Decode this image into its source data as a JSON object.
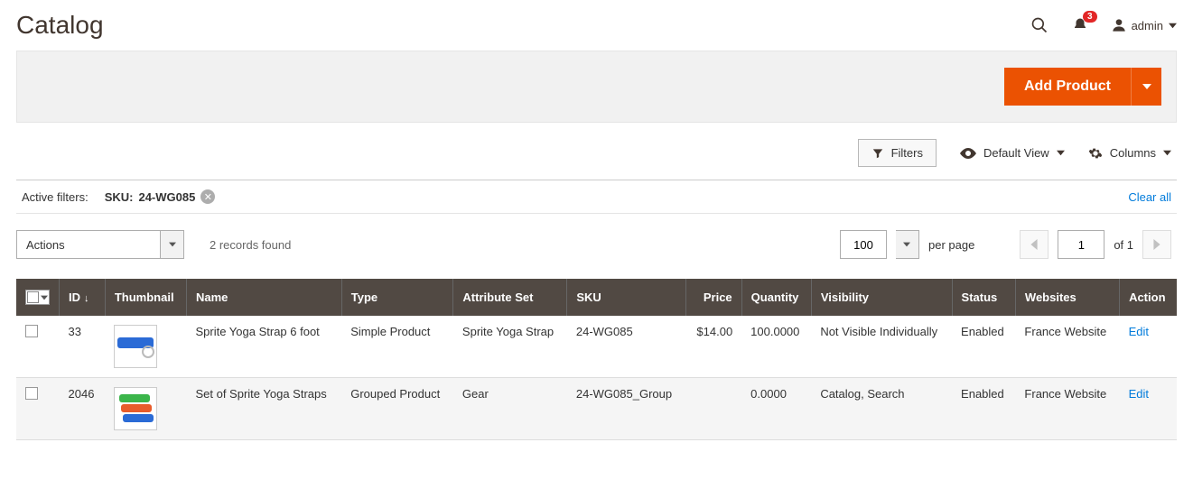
{
  "header": {
    "title": "Catalog",
    "notification_count": "3",
    "admin_label": "admin"
  },
  "toolbar": {
    "add_product_label": "Add Product"
  },
  "controls": {
    "filters_label": "Filters",
    "default_view_label": "Default View",
    "columns_label": "Columns"
  },
  "active_filters": {
    "label": "Active filters:",
    "chip_key": "SKU:",
    "chip_value": "24-WG085",
    "clear_all": "Clear all"
  },
  "grid_top": {
    "actions_label": "Actions",
    "records_found": "2 records found",
    "per_page_value": "100",
    "per_page_label": "per page",
    "page_value": "1",
    "page_of": "of 1"
  },
  "columns": {
    "id": "ID",
    "thumbnail": "Thumbnail",
    "name": "Name",
    "type": "Type",
    "attribute_set": "Attribute Set",
    "sku": "SKU",
    "price": "Price",
    "quantity": "Quantity",
    "visibility": "Visibility",
    "status": "Status",
    "websites": "Websites",
    "action": "Action"
  },
  "rows": [
    {
      "id": "33",
      "name": "Sprite Yoga Strap 6 foot",
      "type": "Simple Product",
      "attribute_set": "Sprite Yoga Strap",
      "sku": "24-WG085",
      "price": "$14.00",
      "quantity": "100.0000",
      "visibility": "Not Visible Individually",
      "status": "Enabled",
      "websites": "France Website",
      "action": "Edit"
    },
    {
      "id": "2046",
      "name": "Set of Sprite Yoga Straps",
      "type": "Grouped Product",
      "attribute_set": "Gear",
      "sku": "24-WG085_Group",
      "price": "",
      "quantity": "0.0000",
      "visibility": "Catalog, Search",
      "status": "Enabled",
      "websites": "France Website",
      "action": "Edit"
    }
  ]
}
